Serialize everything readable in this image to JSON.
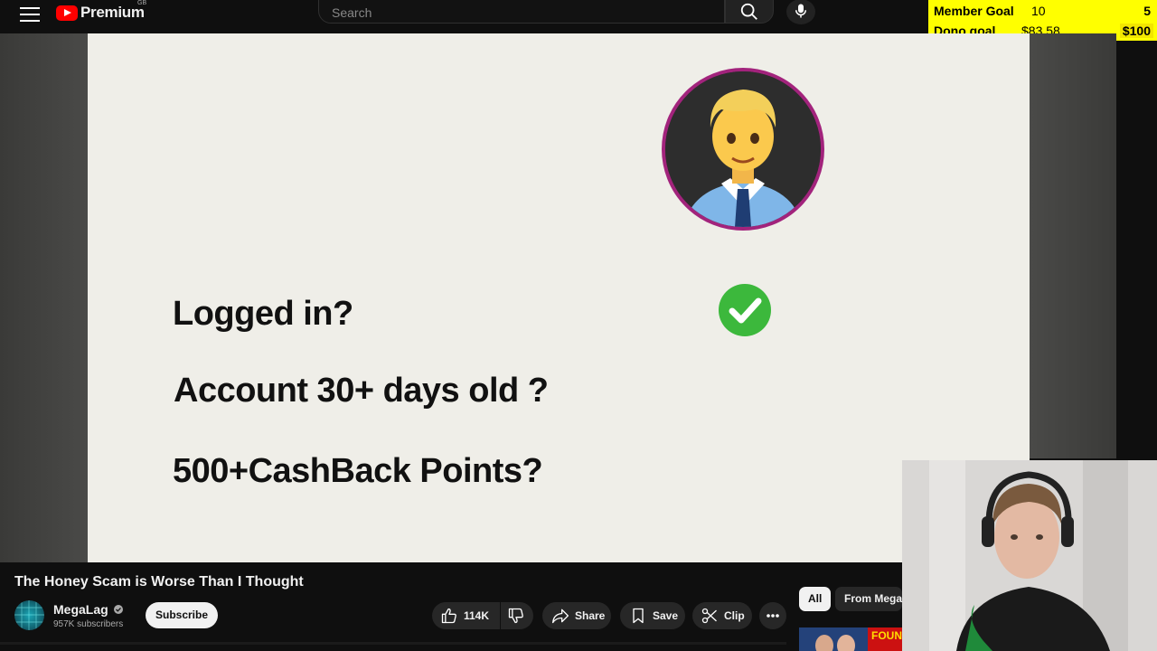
{
  "header": {
    "logo_text": "Premium",
    "logo_region": "GB",
    "search_placeholder": "Search"
  },
  "goal_overlay": {
    "member_label": "Member Goal",
    "member_current": "10",
    "member_target": "5",
    "dono_label": "Dono goal",
    "dono_current": "$83.58",
    "dono_target": "$100",
    "color": "#ffff00"
  },
  "slide": {
    "q1": "Logged in?",
    "q2": "Account 30+ days old ?",
    "q3": "500+CashBack Points?",
    "avatar_icon": "man-office-worker-emoji",
    "check_icon": "green-check-icon"
  },
  "video": {
    "title": "The Honey Scam is Worse Than I Thought",
    "channel_name": "MegaLag",
    "subscribers": "957K subscribers",
    "subscribe_label": "Subscribe",
    "likes": "114K",
    "share_label": "Share",
    "save_label": "Save",
    "clip_label": "Clip"
  },
  "chips": {
    "all": "All",
    "from": "From MegaLag"
  },
  "thumbnail": {
    "text": "FOUN"
  },
  "colors": {
    "brand_red": "#ff0000",
    "accent_purple": "#a2237c",
    "check_green": "#3cb83c"
  }
}
